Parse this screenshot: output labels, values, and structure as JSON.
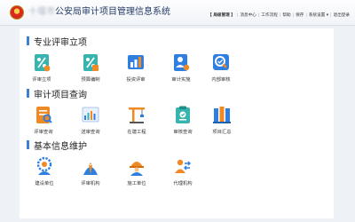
{
  "header": {
    "emblem_icon": "police-emblem-icon",
    "title_blurred": "十堰市",
    "title": "公安局审计项目管理信息系统",
    "toolbar": {
      "user": "【 局级管理 】",
      "messages": "消息中心",
      "workflow": "工作流程",
      "help": "帮助",
      "save": "保存",
      "settings": "系统设置 ▾",
      "logout": "退出登录"
    }
  },
  "sections": [
    {
      "title": "专业评审立项",
      "items": [
        {
          "label": "评审立项",
          "icon": "percent-document-icon"
        },
        {
          "label": "预算编制",
          "icon": "budget-percent-icon"
        },
        {
          "label": "投资评审",
          "icon": "investment-chart-icon"
        },
        {
          "label": "审计实施",
          "icon": "audit-person-icon"
        },
        {
          "label": "内部审核",
          "icon": "internal-review-icon"
        }
      ]
    },
    {
      "title": "审计项目查询",
      "items": [
        {
          "label": "评审查询",
          "icon": "review-search-icon"
        },
        {
          "label": "送审查询",
          "icon": "submit-chart-icon"
        },
        {
          "label": "在建工程",
          "icon": "construction-crane-icon"
        },
        {
          "label": "审核查询",
          "icon": "audit-clipboard-icon"
        },
        {
          "label": "项目汇总",
          "icon": "project-summary-icon"
        }
      ]
    },
    {
      "title": "基本信息维护",
      "items": [
        {
          "label": "建设单位",
          "icon": "gear-person-icon"
        },
        {
          "label": "评审机构",
          "icon": "tie-person-icon"
        },
        {
          "label": "施工单位",
          "icon": "worker-helmet-icon"
        },
        {
          "label": "代理机构",
          "icon": "agency-transfer-icon"
        }
      ]
    }
  ],
  "colors": {
    "accent": "#3d7ed6",
    "title_text": "#243b66",
    "page_bg": "#eef1f6",
    "teal": "#37b3b0",
    "orange": "#f08a24",
    "blue": "#2f7fe0"
  }
}
